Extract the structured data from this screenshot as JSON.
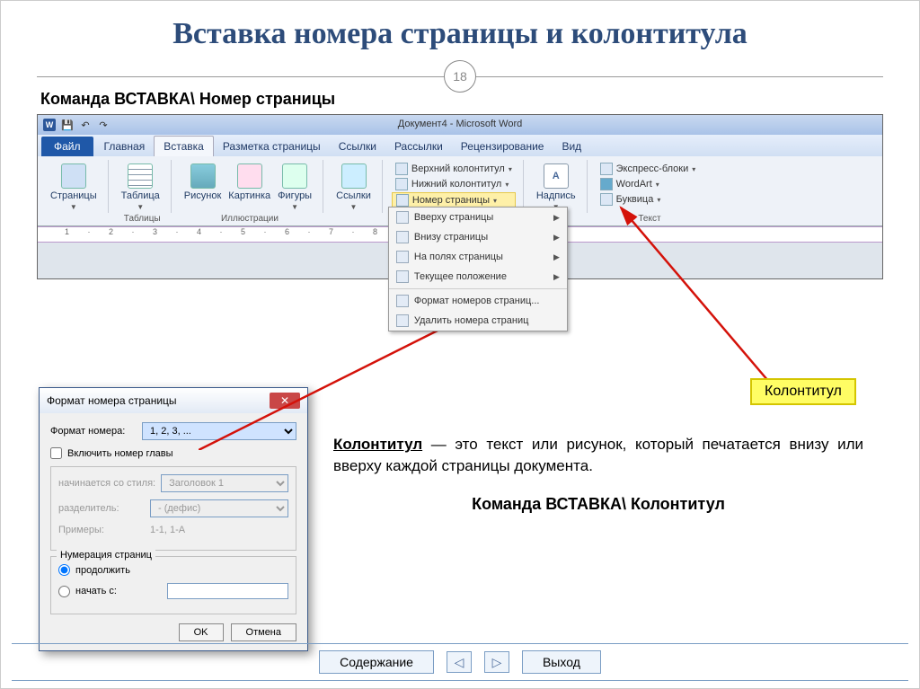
{
  "slide": {
    "title": "Вставка номера страницы и колонтитула",
    "page_number": "18",
    "caption": "Команда  ВСТАВКА\\ Номер страницы"
  },
  "word": {
    "doc_title": "Документ4 - Microsoft Word",
    "tabs": {
      "file": "Файл",
      "home": "Главная",
      "insert": "Вставка",
      "layout": "Разметка страницы",
      "refs": "Ссылки",
      "mail": "Рассылки",
      "review": "Рецензирование",
      "view": "Вид"
    },
    "groups": {
      "pages": {
        "label": "",
        "btn": "Страницы"
      },
      "tables": {
        "label": "Таблицы",
        "btn": "Таблица"
      },
      "illustrations": {
        "label": "Иллюстрации",
        "pic": "Рисунок",
        "clip": "Картинка",
        "shapes": "Фигуры"
      },
      "links": {
        "label": "",
        "btn": "Ссылки"
      },
      "headfoot": {
        "header": "Верхний колонтитул",
        "footer": "Нижний колонтитул",
        "pagenum": "Номер страницы"
      },
      "textgrp": {
        "label": "Текст",
        "textbox": "Надпись",
        "qparts": "Экспресс-блоки",
        "wordart": "WordArt",
        "dropcap": "Буквица"
      }
    },
    "pagenum_menu": {
      "top": "Вверху страницы",
      "bottom": "Внизу страницы",
      "margins": "На полях страницы",
      "current": "Текущее положение",
      "format": "Формат номеров страниц...",
      "remove": "Удалить номера страниц"
    },
    "ruler": "1 · 2 · 3 · 4 · 5 · 6 · 7 · 8 · 9"
  },
  "dialog": {
    "title": "Формат номера страницы",
    "format_label": "Формат номера:",
    "format_value": "1, 2, 3, ...",
    "include_chapter": "Включить номер главы",
    "style_label": "начинается со стиля:",
    "style_value": "Заголовок 1",
    "sep_label": "разделитель:",
    "sep_value": "- (дефис)",
    "examples_label": "Примеры:",
    "examples_value": "1-1, 1-A",
    "numbering_title": "Нумерация страниц",
    "continue": "продолжить",
    "start_at": "начать с:",
    "ok": "OK",
    "cancel": "Отмена"
  },
  "annotations": {
    "callout": "Колонтитул",
    "desc_bold": "Колонтитул",
    "desc_rest": " — это текст или рисунок, который печатается внизу или вверху каждой страницы документа.",
    "cmd2": "Команда  ВСТАВКА\\ Колонтитул"
  },
  "nav": {
    "toc": "Содержание",
    "exit": "Выход"
  }
}
